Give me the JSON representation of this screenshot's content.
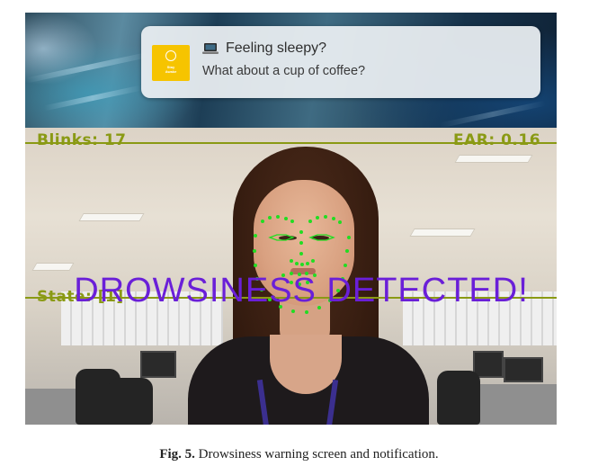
{
  "notification": {
    "app_icon": "yellow-app-logo",
    "title_icon": "laptop-icon",
    "title": "Feeling sleepy?",
    "body": "What about a cup of coffee?"
  },
  "webcam_overlay": {
    "blinks": "Blinks: 17",
    "ear": "EAR: 0.16",
    "state": "State: [1]",
    "alert": "DROWSINESS DETECTED!",
    "colors": {
      "hud": "#8a9a14",
      "alert": "#6a1fd8",
      "landmarks": "#22dd22"
    }
  },
  "caption": {
    "label": "Fig. 5.",
    "text": "Drowsiness warning screen and notification."
  }
}
